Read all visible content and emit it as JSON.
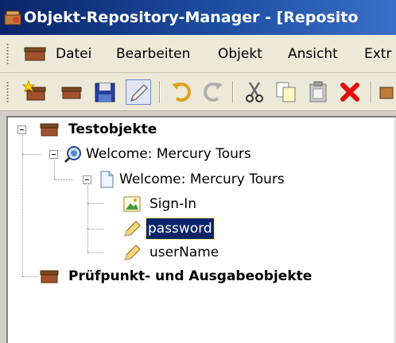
{
  "window": {
    "title": "Objekt-Repository-Manager - [Reposito"
  },
  "menu": {
    "items": [
      {
        "label": "Datei"
      },
      {
        "label": "Bearbeiten"
      },
      {
        "label": "Objekt"
      },
      {
        "label": "Ansicht"
      },
      {
        "label": "Extr"
      }
    ]
  },
  "toolbar": {
    "buttons": [
      {
        "icon": "new-repository-icon"
      },
      {
        "icon": "open-repository-icon"
      },
      {
        "icon": "save-icon"
      },
      {
        "icon": "edit-pencil-icon",
        "pressed": true
      },
      {
        "icon": "undo-icon"
      },
      {
        "icon": "redo-icon"
      },
      {
        "icon": "cut-icon"
      },
      {
        "icon": "copy-icon"
      },
      {
        "icon": "paste-icon"
      },
      {
        "icon": "delete-icon"
      }
    ]
  },
  "tree": {
    "nodes": [
      {
        "label": "Testobjekte",
        "icon": "box-icon",
        "bold": true
      },
      {
        "label": "Welcome: Mercury Tours",
        "icon": "browser-icon"
      },
      {
        "label": "Welcome: Mercury Tours",
        "icon": "page-icon"
      },
      {
        "label": "Sign-In",
        "icon": "image-icon"
      },
      {
        "label": "password",
        "icon": "edit-field-icon",
        "selected": true
      },
      {
        "label": "userName",
        "icon": "edit-field-icon"
      },
      {
        "label": "Prüfpunkt- und Ausgabeobjekte",
        "icon": "box-icon",
        "bold": true
      }
    ]
  }
}
